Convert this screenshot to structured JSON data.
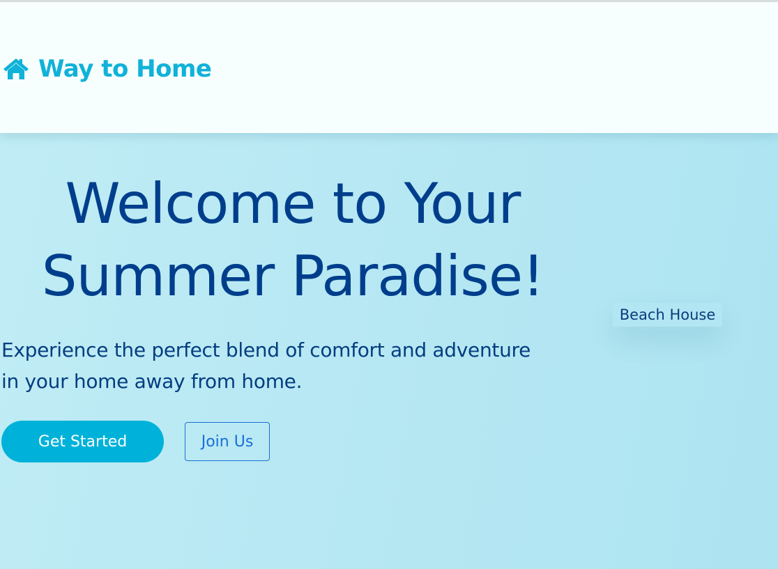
{
  "header": {
    "brand_icon": "home-icon",
    "brand_name": "Way to Home"
  },
  "hero": {
    "title_line1": "Welcome to Your",
    "title_line2": "Summer Paradise!",
    "subtitle_line1": "Experience the perfect blend of comfort and adventure",
    "subtitle_line2": "in your home away from home.",
    "primary_button": "Get Started",
    "secondary_button": "Join Us",
    "badge": "Beach House"
  },
  "colors": {
    "brand": "#10b2d8",
    "heading": "#003e8c",
    "primary_button_bg": "#00b2d9",
    "secondary_button_border": "#1a6fd6",
    "header_bg": "#f7fefe",
    "hero_bg": "#b7e8f3"
  }
}
